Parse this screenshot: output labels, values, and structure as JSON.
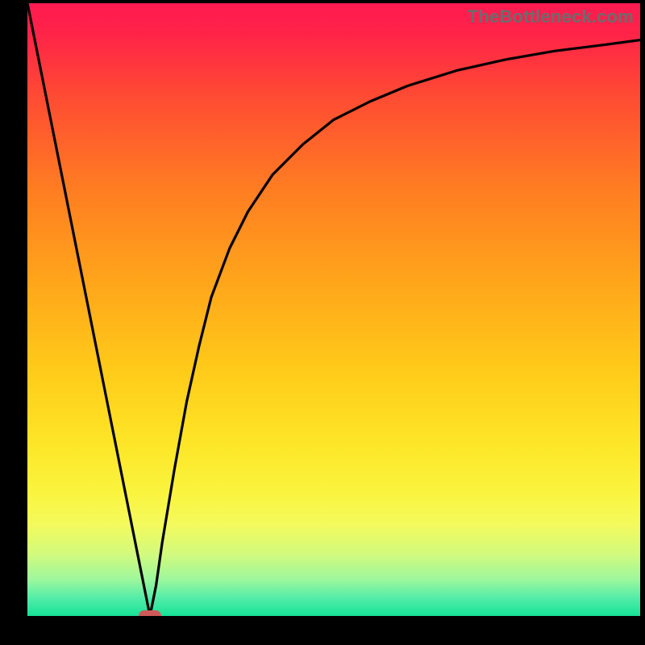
{
  "watermark": "TheBottleneck.com",
  "colors": {
    "background_black": "#000000",
    "gradient_stops": [
      {
        "offset": 0.0,
        "color": "#ff1a51"
      },
      {
        "offset": 0.05,
        "color": "#ff2348"
      },
      {
        "offset": 0.15,
        "color": "#ff4a33"
      },
      {
        "offset": 0.3,
        "color": "#ff7c22"
      },
      {
        "offset": 0.45,
        "color": "#ffa41b"
      },
      {
        "offset": 0.6,
        "color": "#ffcb19"
      },
      {
        "offset": 0.72,
        "color": "#fde627"
      },
      {
        "offset": 0.8,
        "color": "#faf43f"
      },
      {
        "offset": 0.85,
        "color": "#f4fa5c"
      },
      {
        "offset": 0.9,
        "color": "#d1fa7e"
      },
      {
        "offset": 0.94,
        "color": "#9ef79c"
      },
      {
        "offset": 0.97,
        "color": "#55eda9"
      },
      {
        "offset": 1.0,
        "color": "#16e297"
      }
    ],
    "curve": "#000000",
    "marker": "#cf5a59"
  },
  "chart_data": {
    "type": "line",
    "title": "",
    "xlabel": "",
    "ylabel": "",
    "xlim": [
      0,
      100
    ],
    "ylim": [
      0,
      100
    ],
    "grid": false,
    "legend": false,
    "series": [
      {
        "name": "curve",
        "x": [
          0,
          2,
          4,
          6,
          8,
          10,
          12,
          14,
          16,
          18,
          19,
          20,
          21,
          22,
          24,
          26,
          28,
          30,
          33,
          36,
          40,
          45,
          50,
          56,
          62,
          70,
          78,
          86,
          94,
          100
        ],
        "y": [
          100,
          90,
          80,
          70,
          60,
          50,
          40,
          30,
          20,
          10,
          5,
          0,
          5,
          12,
          24,
          35,
          44,
          52,
          60,
          66,
          72,
          77,
          81,
          84,
          86.5,
          89,
          90.8,
          92.2,
          93.2,
          94
        ]
      }
    ],
    "marker": {
      "x": 20,
      "y": 0
    }
  }
}
